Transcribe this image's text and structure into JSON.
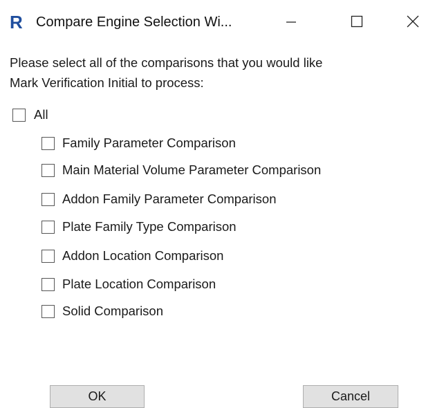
{
  "window": {
    "app_icon_glyph": "R",
    "title": "Compare Engine Selection Wi...",
    "controls": {
      "minimize_icon": "minimize-icon",
      "maximize_icon": "maximize-icon",
      "close_icon": "close-icon"
    }
  },
  "prompt": {
    "line1": "Please select all of the comparisons that you would like",
    "line2": "Mark Verification Initial to process:"
  },
  "select_all": {
    "label": "All",
    "checked": false
  },
  "comparisons": [
    {
      "label": "Family Parameter Comparison",
      "checked": false
    },
    {
      "label": "Main Material Volume Parameter Comparison",
      "checked": false
    },
    {
      "label": "Addon Family Parameter Comparison",
      "checked": false
    },
    {
      "label": "Plate Family Type Comparison",
      "checked": false
    },
    {
      "label": "Addon Location Comparison",
      "checked": false
    },
    {
      "label": "Plate Location Comparison",
      "checked": false
    },
    {
      "label": "Solid Comparison",
      "checked": false
    }
  ],
  "buttons": {
    "ok_label": "OK",
    "cancel_label": "Cancel"
  },
  "colors": {
    "app_icon": "#1f4e9e",
    "button_face": "#e1e1e1",
    "button_border": "#adadad",
    "checkbox_border": "#555555"
  }
}
